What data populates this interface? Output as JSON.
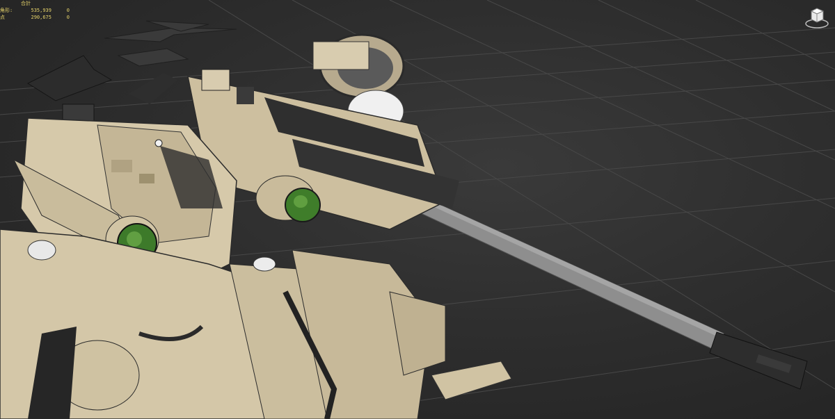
{
  "viewport": {
    "background_color": "#2e2e2e",
    "grid_color": "#4a4a4a"
  },
  "stats": {
    "header": "合計",
    "rows": [
      {
        "label": "ポリゴン/三角形",
        "label_short": "角形:",
        "total": "535,939",
        "selected": "0"
      },
      {
        "label": "頂点",
        "label_short": "点",
        "total": "290,675",
        "selected": "0"
      }
    ]
  },
  "viewcube": {
    "icon": "viewcube-icon"
  },
  "model": {
    "primary_color": "#d4c7a8",
    "dark_color": "#2a2a2a",
    "barrel_color": "#8c8c8c",
    "lens_color": "#3f7d2a"
  }
}
